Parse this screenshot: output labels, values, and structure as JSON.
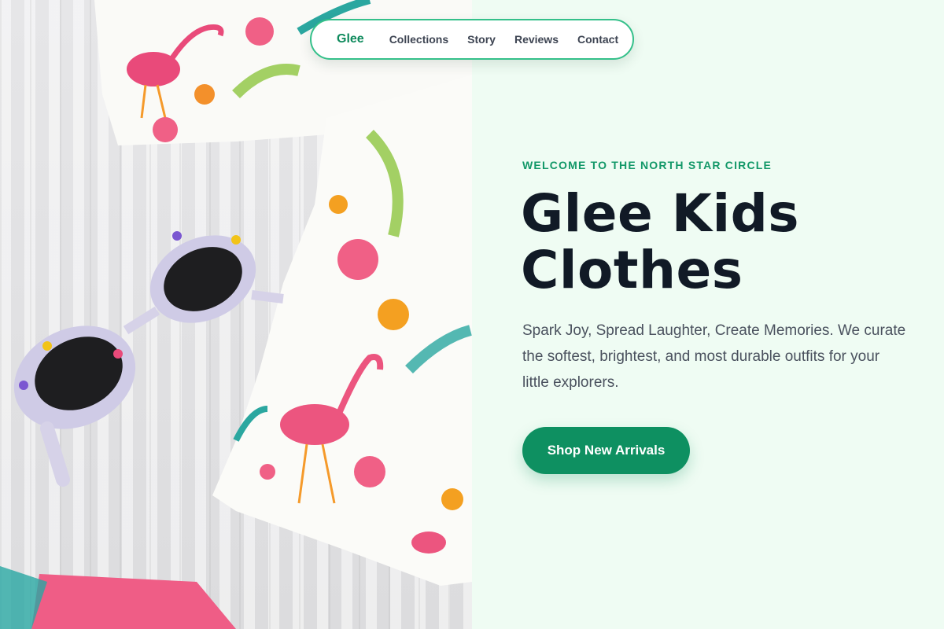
{
  "nav": {
    "logo": "Glee",
    "links": [
      "Collections",
      "Story",
      "Reviews",
      "Contact"
    ]
  },
  "hero": {
    "eyebrow": "WELCOME TO THE NORTH STAR CIRCLE",
    "title_line1": "Glee Kids",
    "title_line2": "Clothes",
    "subtitle": "Spark Joy, Spread Laughter, Create Memories. We curate the softest, brightest, and most durable outfits for your little explorers.",
    "cta_label": "Shop New Arrivals",
    "image_alt": "Flamingo print kids top with floral sunglasses on whitewashed wood"
  },
  "colors": {
    "accent": "#0e9061",
    "eyebrow": "#129868",
    "background": "#effcf3",
    "headline": "#111a26",
    "nav_border": "#34c08a"
  }
}
